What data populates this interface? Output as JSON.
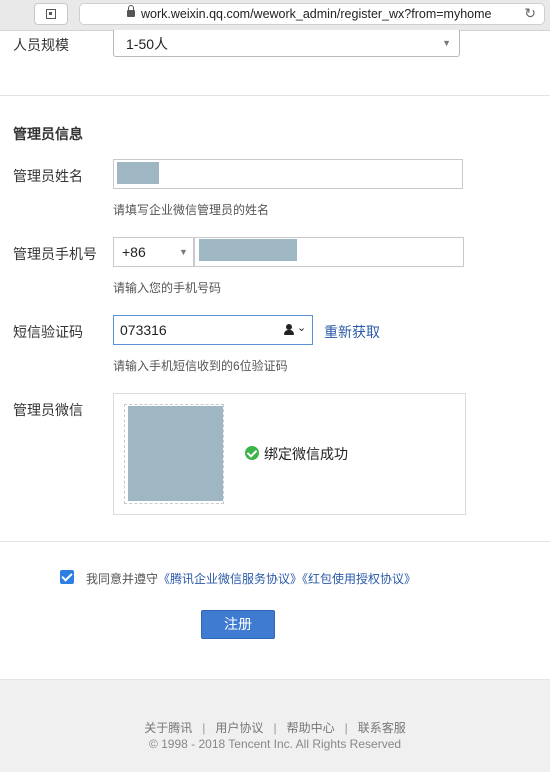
{
  "browser": {
    "url": "work.weixin.qq.com/wework_admin/register_wx?from=myhome"
  },
  "company": {
    "size_label": "人员规模",
    "size_value": "1-50人"
  },
  "admin": {
    "section_title": "管理员信息",
    "name_label": "管理员姓名",
    "name_hint": "请填写企业微信管理员的姓名",
    "phone_label": "管理员手机号",
    "country_code": "+86",
    "phone_hint": "请输入您的手机号码",
    "sms_label": "短信验证码",
    "sms_value": "073316",
    "resend": "重新获取",
    "sms_hint": "请输入手机短信收到的6位验证码",
    "wechat_label": "管理员微信",
    "bind_status": "绑定微信成功"
  },
  "agreement": {
    "prefix": "我同意并遵守",
    "link1": "《腾讯企业微信服务协议》",
    "link2": "《红包使用授权协议》",
    "checked": true
  },
  "submit": "注册",
  "footer": {
    "links": [
      "关于腾讯",
      "用户协议",
      "帮助中心",
      "联系客服"
    ],
    "copyright": "© 1998 - 2018 Tencent Inc. All Rights Reserved"
  },
  "colors": {
    "primary": "#3f7cd1",
    "link": "#2b5aa8",
    "success": "#3bb44a"
  }
}
